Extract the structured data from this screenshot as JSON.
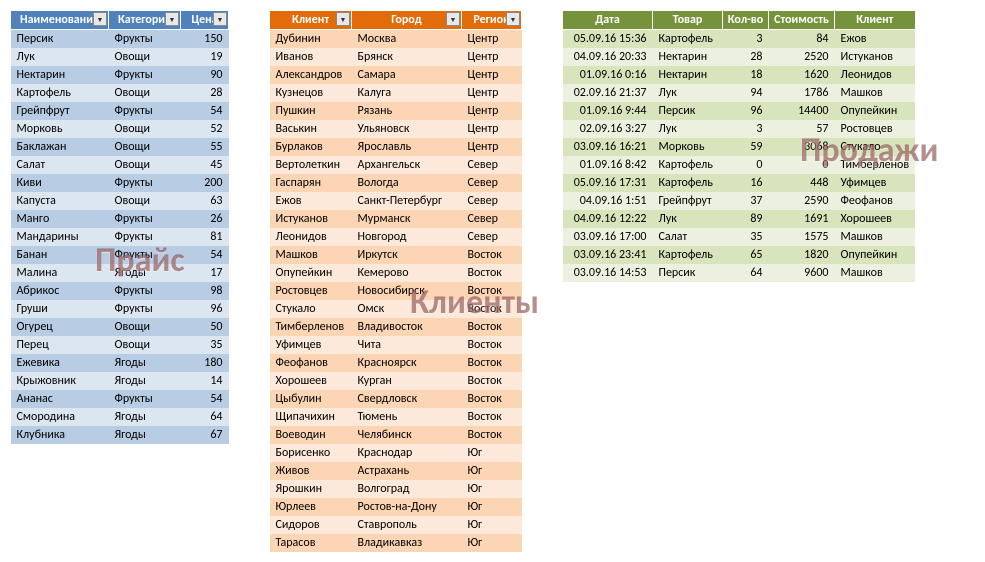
{
  "watermarks": {
    "price": "Прайс",
    "clients": "Клиенты",
    "sales": "Продажи"
  },
  "price": {
    "headers": [
      "Наименование",
      "Категория",
      "Цена"
    ],
    "rows": [
      [
        "Персик",
        "Фрукты",
        "150"
      ],
      [
        "Лук",
        "Овощи",
        "19"
      ],
      [
        "Нектарин",
        "Фрукты",
        "90"
      ],
      [
        "Картофель",
        "Овощи",
        "28"
      ],
      [
        "Грейпфрут",
        "Фрукты",
        "54"
      ],
      [
        "Морковь",
        "Овощи",
        "52"
      ],
      [
        "Баклажан",
        "Овощи",
        "55"
      ],
      [
        "Салат",
        "Овощи",
        "45"
      ],
      [
        "Киви",
        "Фрукты",
        "200"
      ],
      [
        "Капуста",
        "Овощи",
        "63"
      ],
      [
        "Манго",
        "Фрукты",
        "26"
      ],
      [
        "Мандарины",
        "Фрукты",
        "81"
      ],
      [
        "Банан",
        "Фрукты",
        "54"
      ],
      [
        "Малина",
        "Ягоды",
        "17"
      ],
      [
        "Абрикос",
        "Фрукты",
        "98"
      ],
      [
        "Груши",
        "Фрукты",
        "96"
      ],
      [
        "Огурец",
        "Овощи",
        "50"
      ],
      [
        "Перец",
        "Овощи",
        "35"
      ],
      [
        "Ежевика",
        "Ягоды",
        "180"
      ],
      [
        "Крыжовник",
        "Ягоды",
        "14"
      ],
      [
        "Ананас",
        "Фрукты",
        "54"
      ],
      [
        "Смородина",
        "Ягоды",
        "64"
      ],
      [
        "Клубника",
        "Ягоды",
        "67"
      ]
    ]
  },
  "clients": {
    "headers": [
      "Клиент",
      "Город",
      "Регион"
    ],
    "rows": [
      [
        "Дубинин",
        "Москва",
        "Центр"
      ],
      [
        "Иванов",
        "Брянск",
        "Центр"
      ],
      [
        "Александров",
        "Самара",
        "Центр"
      ],
      [
        "Кузнецов",
        "Калуга",
        "Центр"
      ],
      [
        "Пушкин",
        "Рязань",
        "Центр"
      ],
      [
        "Васькин",
        "Ульяновск",
        "Центр"
      ],
      [
        "Бурлаков",
        "Ярославль",
        "Центр"
      ],
      [
        "Вертолеткин",
        "Архангельск",
        "Север"
      ],
      [
        "Гаспарян",
        "Вологда",
        "Север"
      ],
      [
        "Ежов",
        "Санкт-Петербург",
        "Север"
      ],
      [
        "Истуканов",
        "Мурманск",
        "Север"
      ],
      [
        "Леонидов",
        "Новгород",
        "Север"
      ],
      [
        "Машков",
        "Иркутск",
        "Восток"
      ],
      [
        "Опупейкин",
        "Кемерово",
        "Восток"
      ],
      [
        "Ростовцев",
        "Новосибирск",
        "Восток"
      ],
      [
        "Стукало",
        "Омск",
        "Восток"
      ],
      [
        "Тимберленов",
        "Владивосток",
        "Восток"
      ],
      [
        "Уфимцев",
        "Чита",
        "Восток"
      ],
      [
        "Феофанов",
        "Красноярск",
        "Восток"
      ],
      [
        "Хорошеев",
        "Курган",
        "Восток"
      ],
      [
        "Цыбулин",
        "Свердловск",
        "Восток"
      ],
      [
        "Щипачихин",
        "Тюмень",
        "Восток"
      ],
      [
        "Воеводин",
        "Челябинск",
        "Восток"
      ],
      [
        "Борисенко",
        "Краснодар",
        "Юг"
      ],
      [
        "Живов",
        "Астрахань",
        "Юг"
      ],
      [
        "Ярошкин",
        "Волгоград",
        "Юг"
      ],
      [
        "Юрлеев",
        "Ростов-на-Дону",
        "Юг"
      ],
      [
        "Сидоров",
        "Ставрополь",
        "Юг"
      ],
      [
        "Тарасов",
        "Владикавказ",
        "Юг"
      ]
    ]
  },
  "sales": {
    "headers": [
      "Дата",
      "Товар",
      "Кол-во",
      "Стоимость",
      "Клиент"
    ],
    "rows": [
      [
        "05.09.16 15:36",
        "Картофель",
        "3",
        "84",
        "Ежов"
      ],
      [
        "04.09.16 20:33",
        "Нектарин",
        "28",
        "2520",
        "Истуканов"
      ],
      [
        "01.09.16 0:16",
        "Нектарин",
        "18",
        "1620",
        "Леонидов"
      ],
      [
        "02.09.16 21:37",
        "Лук",
        "94",
        "1786",
        "Машков"
      ],
      [
        "01.09.16 9:44",
        "Персик",
        "96",
        "14400",
        "Опупейкин"
      ],
      [
        "02.09.16 3:27",
        "Лук",
        "3",
        "57",
        "Ростовцев"
      ],
      [
        "03.09.16 16:21",
        "Морковь",
        "59",
        "3068",
        "Стукало"
      ],
      [
        "01.09.16 8:42",
        "Картофель",
        "0",
        "0",
        "Тимберленов"
      ],
      [
        "05.09.16 17:31",
        "Картофель",
        "16",
        "448",
        "Уфимцев"
      ],
      [
        "04.09.16 1:51",
        "Грейпфрут",
        "37",
        "2590",
        "Феофанов"
      ],
      [
        "04.09.16 12:22",
        "Лук",
        "89",
        "1691",
        "Хорошеев"
      ],
      [
        "03.09.16 17:00",
        "Салат",
        "35",
        "1575",
        "Машков"
      ],
      [
        "03.09.16 23:41",
        "Картофель",
        "65",
        "1820",
        "Опупейкин"
      ],
      [
        "03.09.16 14:53",
        "Персик",
        "64",
        "9600",
        "Машков"
      ]
    ]
  },
  "chart_data": [
    {
      "type": "table",
      "title": "Прайс",
      "columns": [
        "Наименование",
        "Категория",
        "Цена"
      ],
      "rows": [
        [
          "Персик",
          "Фрукты",
          150
        ],
        [
          "Лук",
          "Овощи",
          19
        ],
        [
          "Нектарин",
          "Фрукты",
          90
        ],
        [
          "Картофель",
          "Овощи",
          28
        ],
        [
          "Грейпфрут",
          "Фрукты",
          54
        ],
        [
          "Морковь",
          "Овощи",
          52
        ],
        [
          "Баклажан",
          "Овощи",
          55
        ],
        [
          "Салат",
          "Овощи",
          45
        ],
        [
          "Киви",
          "Фрукты",
          200
        ],
        [
          "Капуста",
          "Овощи",
          63
        ],
        [
          "Манго",
          "Фрукты",
          26
        ],
        [
          "Мандарины",
          "Фрукты",
          81
        ],
        [
          "Банан",
          "Фрукты",
          54
        ],
        [
          "Малина",
          "Ягоды",
          17
        ],
        [
          "Абрикос",
          "Фрукты",
          98
        ],
        [
          "Груши",
          "Фрукты",
          96
        ],
        [
          "Огурец",
          "Овощи",
          50
        ],
        [
          "Перец",
          "Овощи",
          35
        ],
        [
          "Ежевика",
          "Ягоды",
          180
        ],
        [
          "Крыжовник",
          "Ягоды",
          14
        ],
        [
          "Ананас",
          "Фрукты",
          54
        ],
        [
          "Смородина",
          "Ягоды",
          64
        ],
        [
          "Клубника",
          "Ягоды",
          67
        ]
      ]
    },
    {
      "type": "table",
      "title": "Клиенты",
      "columns": [
        "Клиент",
        "Город",
        "Регион"
      ],
      "rows": [
        [
          "Дубинин",
          "Москва",
          "Центр"
        ],
        [
          "Иванов",
          "Брянск",
          "Центр"
        ],
        [
          "Александров",
          "Самара",
          "Центр"
        ],
        [
          "Кузнецов",
          "Калуга",
          "Центр"
        ],
        [
          "Пушкин",
          "Рязань",
          "Центр"
        ],
        [
          "Васькин",
          "Ульяновск",
          "Центр"
        ],
        [
          "Бурлаков",
          "Ярославль",
          "Центр"
        ],
        [
          "Вертолеткин",
          "Архангельск",
          "Север"
        ],
        [
          "Гаспарян",
          "Вологда",
          "Север"
        ],
        [
          "Ежов",
          "Санкт-Петербург",
          "Север"
        ],
        [
          "Истуканов",
          "Мурманск",
          "Север"
        ],
        [
          "Леонидов",
          "Новгород",
          "Север"
        ],
        [
          "Машков",
          "Иркутск",
          "Восток"
        ],
        [
          "Опупейкин",
          "Кемерово",
          "Восток"
        ],
        [
          "Ростовцев",
          "Новосибирск",
          "Восток"
        ],
        [
          "Стукало",
          "Омск",
          "Восток"
        ],
        [
          "Тимберленов",
          "Владивосток",
          "Восток"
        ],
        [
          "Уфимцев",
          "Чита",
          "Восток"
        ],
        [
          "Феофанов",
          "Красноярск",
          "Восток"
        ],
        [
          "Хорошеев",
          "Курган",
          "Восток"
        ],
        [
          "Цыбулин",
          "Свердловск",
          "Восток"
        ],
        [
          "Щипачихин",
          "Тюмень",
          "Восток"
        ],
        [
          "Воеводин",
          "Челябинск",
          "Восток"
        ],
        [
          "Борисенко",
          "Краснодар",
          "Юг"
        ],
        [
          "Живов",
          "Астрахань",
          "Юг"
        ],
        [
          "Ярошкин",
          "Волгоград",
          "Юг"
        ],
        [
          "Юрлеев",
          "Ростов-на-Дону",
          "Юг"
        ],
        [
          "Сидоров",
          "Ставрополь",
          "Юг"
        ],
        [
          "Тарасов",
          "Владикавказ",
          "Юг"
        ]
      ]
    },
    {
      "type": "table",
      "title": "Продажи",
      "columns": [
        "Дата",
        "Товар",
        "Кол-во",
        "Стоимость",
        "Клиент"
      ],
      "rows": [
        [
          "05.09.16 15:36",
          "Картофель",
          3,
          84,
          "Ежов"
        ],
        [
          "04.09.16 20:33",
          "Нектарин",
          28,
          2520,
          "Истуканов"
        ],
        [
          "01.09.16 0:16",
          "Нектарин",
          18,
          1620,
          "Леонидов"
        ],
        [
          "02.09.16 21:37",
          "Лук",
          94,
          1786,
          "Машков"
        ],
        [
          "01.09.16 9:44",
          "Персик",
          96,
          14400,
          "Опупейкин"
        ],
        [
          "02.09.16 3:27",
          "Лук",
          3,
          57,
          "Ростовцев"
        ],
        [
          "03.09.16 16:21",
          "Морковь",
          59,
          3068,
          "Стукало"
        ],
        [
          "01.09.16 8:42",
          "Картофель",
          0,
          0,
          "Тимберленов"
        ],
        [
          "05.09.16 17:31",
          "Картофель",
          16,
          448,
          "Уфимцев"
        ],
        [
          "04.09.16 1:51",
          "Грейпфрут",
          37,
          2590,
          "Феофанов"
        ],
        [
          "04.09.16 12:22",
          "Лук",
          89,
          1691,
          "Хорошеев"
        ],
        [
          "03.09.16 17:00",
          "Салат",
          35,
          1575,
          "Машков"
        ],
        [
          "03.09.16 23:41",
          "Картофель",
          65,
          1820,
          "Опупейкин"
        ],
        [
          "03.09.16 14:53",
          "Персик",
          64,
          9600,
          "Машков"
        ]
      ]
    }
  ]
}
